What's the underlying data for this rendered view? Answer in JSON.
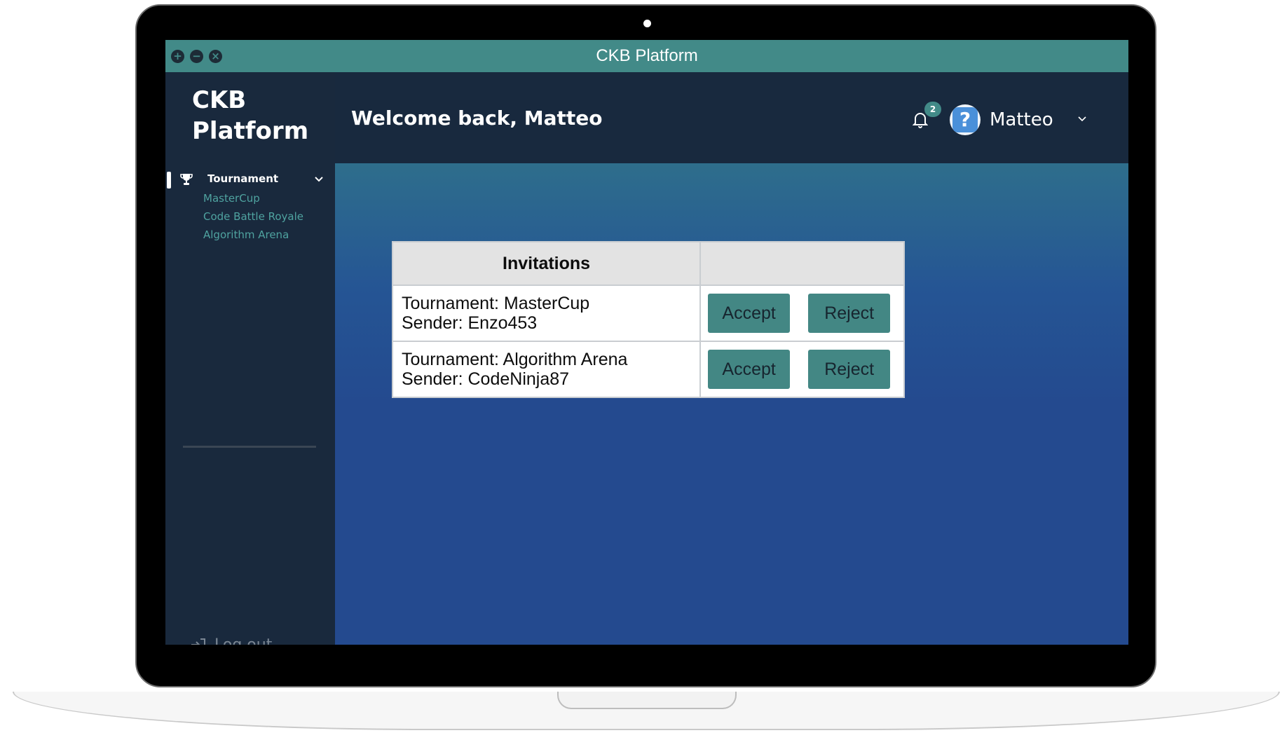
{
  "window": {
    "title": "CKB Platform",
    "controls": [
      {
        "name": "maximize-icon",
        "glyph": "+"
      },
      {
        "name": "minimize-icon",
        "glyph": "−"
      },
      {
        "name": "close-icon",
        "glyph": "×"
      }
    ]
  },
  "sidebar": {
    "brand_line1": "CKB",
    "brand_line2": "Platform",
    "nav": {
      "label": "Tournament",
      "icon": "trophy-icon",
      "expanded": true,
      "items": [
        {
          "label": "MasterCup"
        },
        {
          "label": "Code Battle Royale"
        },
        {
          "label": "Algorithm Arena"
        }
      ]
    },
    "logout_label": "Log out"
  },
  "header": {
    "welcome": "Welcome back, Matteo",
    "notification_count": "2",
    "username": "Matteo"
  },
  "invitations": {
    "header": "Invitations",
    "action_header": "",
    "rows": [
      {
        "tournament": "Tournament: MasterCup",
        "sender": "Sender: Enzo453",
        "accept_label": "Accept",
        "reject_label": "Reject"
      },
      {
        "tournament": "Tournament: Algorithm Arena",
        "sender": "Sender: CodeNinja87",
        "accept_label": "Accept",
        "reject_label": "Reject"
      }
    ]
  },
  "colors": {
    "titlebar": "#428a88",
    "sidebar_bg": "#19293d",
    "accent_teal": "#428a88",
    "submenu_link": "#4fa3a0",
    "main_gradient_top": "#2e6e8c",
    "main_gradient_bottom": "#244a8f"
  }
}
